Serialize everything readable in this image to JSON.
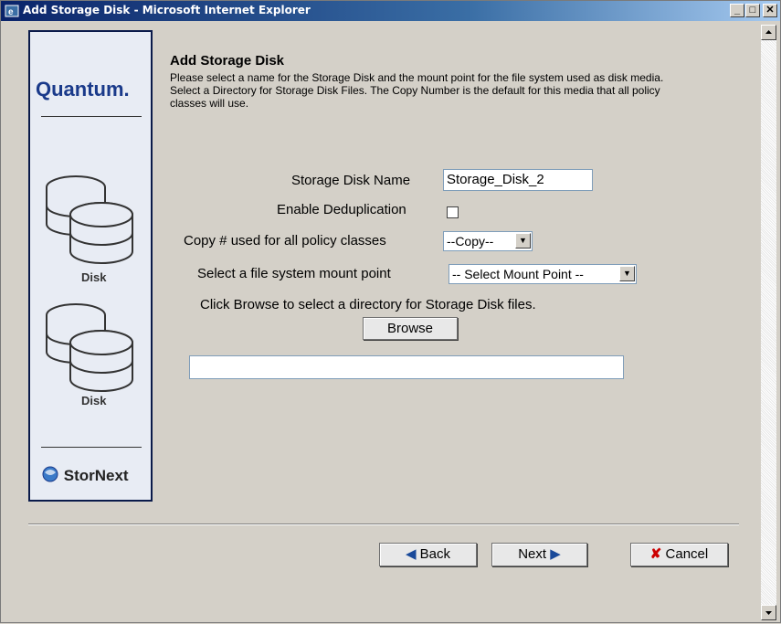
{
  "window": {
    "title": "Add Storage Disk - Microsoft Internet Explorer",
    "minimize": "_",
    "maximize": "□",
    "close": "✕"
  },
  "sidebar": {
    "brand": "Quantum.",
    "disk_label_1": "Disk",
    "disk_label_2": "Disk",
    "footer_brand": "StorNext"
  },
  "page": {
    "title": "Add Storage Disk",
    "description": "Please select a name for the Storage Disk and the mount point for the file system used as disk media. Select a Directory for Storage Disk Files. The Copy Number is the default for this media that all policy classes will use."
  },
  "form": {
    "name_label": "Storage Disk Name",
    "name_value": "Storage_Disk_2",
    "dedup_label": "Enable Deduplication",
    "dedup_checked": false,
    "copy_label": "Copy # used for all policy classes",
    "copy_value": "--Copy--",
    "mount_label": "Select a file system mount point",
    "mount_value": "-- Select Mount Point --",
    "browse_hint": "Click Browse to select a directory for Storage Disk files.",
    "browse_button": "Browse",
    "directory_value": ""
  },
  "buttons": {
    "back": "Back",
    "next": "Next",
    "cancel": "Cancel"
  },
  "icons": {
    "window_icon": "ie-icon",
    "disk_icon": "disk-stack-icon",
    "back_arrow": "left-arrow-icon",
    "next_arrow": "right-arrow-icon",
    "cancel_x": "x-icon"
  },
  "colors": {
    "title_bar": "#0a246a",
    "accent_blue": "#1a3a8a",
    "cancel_red": "#cc0000"
  }
}
